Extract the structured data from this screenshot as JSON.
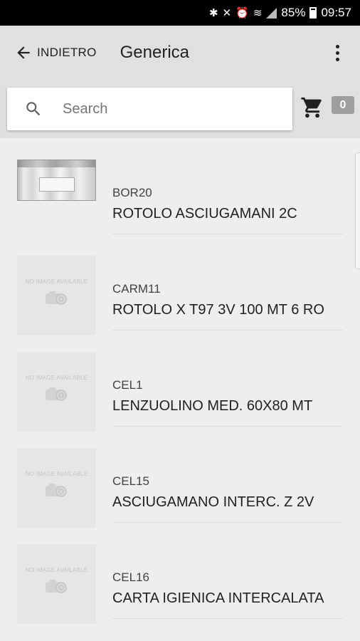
{
  "status_bar": {
    "battery": "85%",
    "time": "09:57"
  },
  "app_bar": {
    "back_label": "INDIETRO",
    "title": "Generica"
  },
  "search": {
    "placeholder": "Search"
  },
  "cart": {
    "count": "0"
  },
  "no_image_text": "NO IMAGE AVAILABLE",
  "items": [
    {
      "code": "BOR20",
      "name": "ROTOLO ASCIUGAMANI 2C",
      "image": "product-photo"
    },
    {
      "code": "CARM11",
      "name": "ROTOLO X T97 3V 100 MT 6 RO",
      "image": "no-image"
    },
    {
      "code": "CEL1",
      "name": "LENZUOLINO MED. 60X80 MT",
      "image": "no-image"
    },
    {
      "code": "CEL15",
      "name": "ASCIUGAMANO INTERC. Z 2V",
      "image": "no-image"
    },
    {
      "code": "CEL16",
      "name": "CARTA IGIENICA INTERCALATA",
      "image": "no-image"
    }
  ],
  "colors": {
    "app_bar": "#e0e0e0",
    "background": "#eeeeee",
    "badge": "#9e9e9e"
  }
}
